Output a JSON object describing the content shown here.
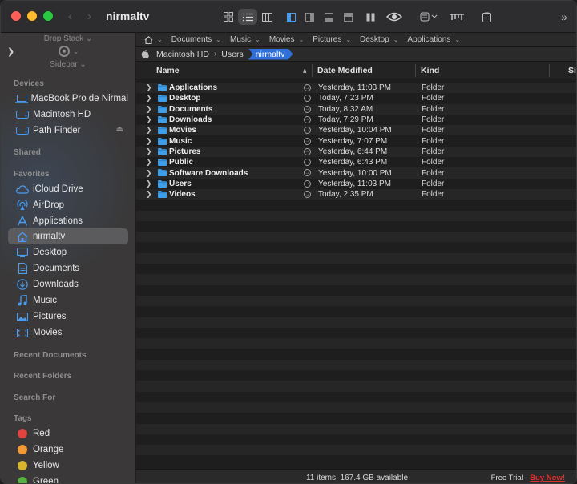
{
  "window": {
    "title": "nirmaltv"
  },
  "sidebar": {
    "drop_stack_label": "Drop Stack ⌄",
    "sidebar_label": "Sidebar ⌄",
    "sections": {
      "devices": "Devices",
      "shared": "Shared",
      "favorites": "Favorites",
      "recent_documents": "Recent Documents",
      "recent_folders": "Recent Folders",
      "search_for": "Search For",
      "tags": "Tags"
    },
    "devices": [
      {
        "label": "MacBook Pro de Nirmal",
        "icon": "laptop-icon"
      },
      {
        "label": "Macintosh HD",
        "icon": "drive-icon"
      },
      {
        "label": "Path Finder",
        "icon": "drive-icon"
      }
    ],
    "favorites": [
      {
        "label": "iCloud Drive",
        "icon": "cloud-icon"
      },
      {
        "label": "AirDrop",
        "icon": "airdrop-icon"
      },
      {
        "label": "Applications",
        "icon": "applications-icon"
      },
      {
        "label": "nirmaltv",
        "icon": "home-icon",
        "selected": true
      },
      {
        "label": "Desktop",
        "icon": "desktop-icon"
      },
      {
        "label": "Documents",
        "icon": "document-icon"
      },
      {
        "label": "Downloads",
        "icon": "download-icon"
      },
      {
        "label": "Music",
        "icon": "music-icon"
      },
      {
        "label": "Pictures",
        "icon": "pictures-icon"
      },
      {
        "label": "Movies",
        "icon": "movies-icon"
      }
    ],
    "tags": [
      {
        "label": "Red",
        "color": "#e0443e"
      },
      {
        "label": "Orange",
        "color": "#f19a37"
      },
      {
        "label": "Yellow",
        "color": "#d7b52f"
      },
      {
        "label": "Green",
        "color": "#57b140"
      }
    ]
  },
  "pathbar": {
    "items": [
      "Documents",
      "Music",
      "Movies",
      "Pictures",
      "Desktop",
      "Applications"
    ]
  },
  "breadcrumb": {
    "items": [
      "Macintosh HD",
      "Users"
    ],
    "current": "nirmaltv"
  },
  "columns": {
    "name": "Name",
    "date_modified": "Date Modified",
    "kind": "Kind",
    "size": "Size"
  },
  "files": [
    {
      "name": "Applications",
      "date": "Yesterday, 11:03 PM",
      "kind": "Folder"
    },
    {
      "name": "Desktop",
      "date": "Today, 7:23 PM",
      "kind": "Folder"
    },
    {
      "name": "Documents",
      "date": "Today, 8:32 AM",
      "kind": "Folder"
    },
    {
      "name": "Downloads",
      "date": "Today, 7:29 PM",
      "kind": "Folder"
    },
    {
      "name": "Movies",
      "date": "Yesterday, 10:04 PM",
      "kind": "Folder"
    },
    {
      "name": "Music",
      "date": "Yesterday, 7:07 PM",
      "kind": "Folder"
    },
    {
      "name": "Pictures",
      "date": "Yesterday, 6:44 PM",
      "kind": "Folder"
    },
    {
      "name": "Public",
      "date": "Yesterday, 6:43 PM",
      "kind": "Folder"
    },
    {
      "name": "Software Downloads",
      "date": "Yesterday, 10:00 PM",
      "kind": "Folder"
    },
    {
      "name": "Users",
      "date": "Yesterday, 11:03 PM",
      "kind": "Folder"
    },
    {
      "name": "Videos",
      "date": "Today, 2:35 PM",
      "kind": "Folder"
    }
  ],
  "status": {
    "info": "11 items, 167.4 GB available",
    "trial_text": "Free Trial - ",
    "buy_text": "Buy Now!"
  },
  "colors": {
    "accent": "#2e6fdb",
    "folder": "#3f9ee8",
    "sidebar_icon": "#4a9cf0",
    "buy_now": "#e0322d"
  }
}
